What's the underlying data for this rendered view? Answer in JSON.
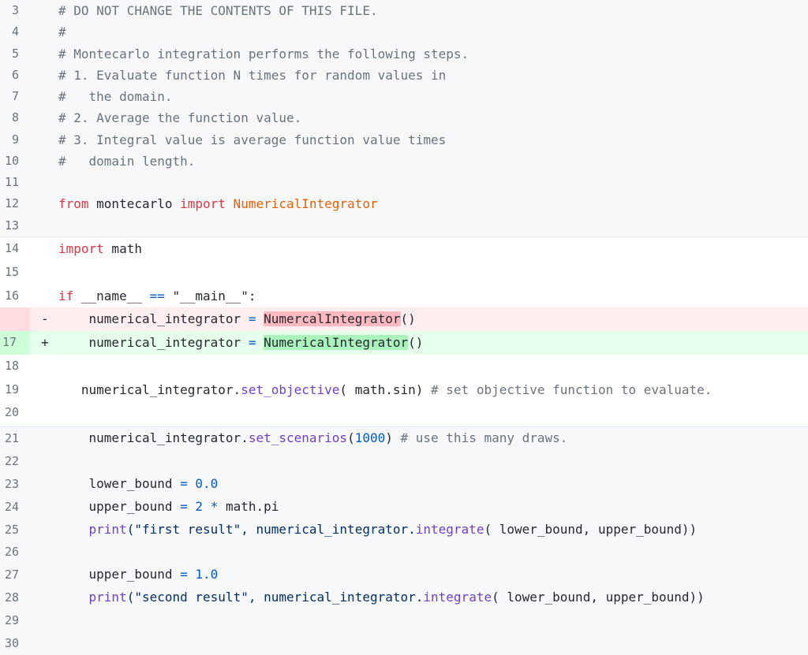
{
  "diff": {
    "sections": [
      {
        "bg": "gray",
        "lines": [
          {
            "num": "3",
            "marker": "",
            "tokens": [
              {
                "t": "# DO NOT CHANGE THE CONTENTS OF THIS FILE.",
                "c": "cm"
              }
            ]
          },
          {
            "num": "4",
            "marker": "",
            "tokens": [
              {
                "t": "#",
                "c": "cm"
              }
            ]
          },
          {
            "num": "5",
            "marker": "",
            "tokens": [
              {
                "t": "# Montecarlo integration performs the following steps.",
                "c": "cm"
              }
            ]
          },
          {
            "num": "6",
            "marker": "",
            "tokens": [
              {
                "t": "# 1. Evaluate function N times for random values in",
                "c": "cm"
              }
            ]
          },
          {
            "num": "7",
            "marker": "",
            "tokens": [
              {
                "t": "#   the domain.",
                "c": "cm"
              }
            ]
          },
          {
            "num": "8",
            "marker": "",
            "tokens": [
              {
                "t": "# 2. Average the function value.",
                "c": "cm"
              }
            ]
          },
          {
            "num": "9",
            "marker": "",
            "tokens": [
              {
                "t": "# 3. Integral value is average function value times",
                "c": "cm"
              }
            ]
          },
          {
            "num": "10",
            "marker": "",
            "tokens": [
              {
                "t": "#   domain length.",
                "c": "cm"
              }
            ]
          },
          {
            "num": "11",
            "marker": "",
            "tokens": []
          },
          {
            "num": "12",
            "marker": "",
            "tokens": [
              {
                "t": "from",
                "c": "kw"
              },
              {
                "t": " montecarlo ",
                "c": "plain"
              },
              {
                "t": "import",
                "c": "kw"
              },
              {
                "t": " NumericalIntegrator",
                "c": "cls"
              }
            ]
          },
          {
            "num": "13",
            "marker": "",
            "tokens": []
          }
        ]
      },
      {
        "bg": "white",
        "lines": [
          {
            "num": "14",
            "marker": "",
            "tokens": [
              {
                "t": "import",
                "c": "kw"
              },
              {
                "t": " math",
                "c": "plain"
              }
            ]
          },
          {
            "num": "15",
            "marker": "",
            "tokens": []
          },
          {
            "num": "16",
            "marker": "",
            "tokens": [
              {
                "t": "if",
                "c": "kw"
              },
              {
                "t": " __name__ ",
                "c": "plain"
              },
              {
                "t": "==",
                "c": "op"
              },
              {
                "t": " \"__main__\":",
                "c": "plain"
              }
            ]
          },
          {
            "num": "",
            "marker": "-",
            "type": "del",
            "tokens": [
              {
                "t": "    numerical_integrator ",
                "c": "plain"
              },
              {
                "t": "=",
                "c": "op"
              },
              {
                "t": " ",
                "c": "plain"
              },
              {
                "t": "NumercalIntegrator",
                "c": "hl-del"
              },
              {
                "t": "()",
                "c": "plain"
              }
            ]
          },
          {
            "num": "17",
            "marker": "+",
            "type": "add",
            "tokens": [
              {
                "t": "    numerical_integrator ",
                "c": "plain"
              },
              {
                "t": "=",
                "c": "op"
              },
              {
                "t": " ",
                "c": "plain"
              },
              {
                "t": "NumericalIntegrator",
                "c": "hl-add"
              },
              {
                "t": "()",
                "c": "plain"
              }
            ]
          },
          {
            "num": "18",
            "marker": "",
            "tokens": []
          },
          {
            "num": "19",
            "marker": "",
            "tokens": [
              {
                "t": "   numerical_integrator.",
                "c": "plain"
              },
              {
                "t": "set_objective",
                "c": "fn"
              },
              {
                "t": "( math.sin) ",
                "c": "plain"
              },
              {
                "t": "# set objective function to evaluate.",
                "c": "cm"
              }
            ]
          },
          {
            "num": "20",
            "marker": "",
            "tokens": []
          }
        ]
      },
      {
        "bg": "gray",
        "lines": [
          {
            "num": "21",
            "marker": "",
            "tokens": [
              {
                "t": "    numerical_integrator.",
                "c": "plain"
              },
              {
                "t": "set_scenarios",
                "c": "fn"
              },
              {
                "t": "(",
                "c": "plain"
              },
              {
                "t": "1000",
                "c": "num"
              },
              {
                "t": ") ",
                "c": "plain"
              },
              {
                "t": "# use this many draws.",
                "c": "cm"
              }
            ]
          },
          {
            "num": "22",
            "marker": "",
            "tokens": []
          },
          {
            "num": "23",
            "marker": "",
            "tokens": [
              {
                "t": "    lower_bound ",
                "c": "plain"
              },
              {
                "t": "=",
                "c": "op"
              },
              {
                "t": " ",
                "c": "plain"
              },
              {
                "t": "0.0",
                "c": "num"
              }
            ]
          },
          {
            "num": "24",
            "marker": "",
            "tokens": [
              {
                "t": "    upper_bound ",
                "c": "plain"
              },
              {
                "t": "=",
                "c": "op"
              },
              {
                "t": " ",
                "c": "plain"
              },
              {
                "t": "2",
                "c": "num"
              },
              {
                "t": " ",
                "c": "plain"
              },
              {
                "t": "*",
                "c": "op"
              },
              {
                "t": " math.pi",
                "c": "plain"
              }
            ]
          },
          {
            "num": "25",
            "marker": "",
            "tokens": [
              {
                "t": "    ",
                "c": "plain"
              },
              {
                "t": "print",
                "c": "fn"
              },
              {
                "t": "(\"first result\", numerical_integrator.",
                "c": "str"
              },
              {
                "t": "integrate",
                "c": "fn"
              },
              {
                "t": "( lower_bound, upper_bound))",
                "c": "plain"
              }
            ]
          },
          {
            "num": "26",
            "marker": "",
            "tokens": []
          },
          {
            "num": "27",
            "marker": "",
            "tokens": [
              {
                "t": "    upper_bound ",
                "c": "plain"
              },
              {
                "t": "=",
                "c": "op"
              },
              {
                "t": " ",
                "c": "plain"
              },
              {
                "t": "1.0",
                "c": "num"
              }
            ]
          },
          {
            "num": "28",
            "marker": "",
            "tokens": [
              {
                "t": "    ",
                "c": "plain"
              },
              {
                "t": "print",
                "c": "fn"
              },
              {
                "t": "(\"second result\", numerical_integrator.",
                "c": "str"
              },
              {
                "t": "integrate",
                "c": "fn"
              },
              {
                "t": "( lower_bound, upper_bound))",
                "c": "plain"
              }
            ]
          },
          {
            "num": "29",
            "marker": "",
            "tokens": []
          },
          {
            "num": "30",
            "marker": "",
            "tokens": []
          }
        ]
      }
    ]
  },
  "colors": {
    "deleted_line_bg": "#ffeef0",
    "added_line_bg": "#e6ffed",
    "deleted_highlight": "#fdb8c0",
    "added_highlight": "#acf2bd",
    "keyword": "#d73a49",
    "class_name": "#e36209",
    "comment": "#6a737d",
    "number": "#005cc5",
    "function": "#6f42c1"
  }
}
